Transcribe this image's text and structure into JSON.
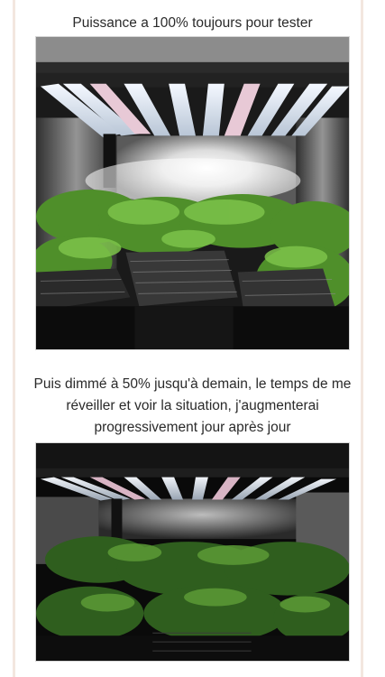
{
  "post": {
    "caption_1": "Puissance a 100% toujours pour tester",
    "caption_2": "Puis dimmé à 50% jusqu'à demain, le temps de me réveiller et voir la situation, j'augmenterai progressivement jour après jour"
  },
  "photos": [
    {
      "icon": "grow-tent-full-power-photo",
      "light_level_percent": 100
    },
    {
      "icon": "grow-tent-dimmed-photo",
      "light_level_percent": 50
    }
  ],
  "colors": {
    "background": "#ffffff",
    "text": "#2a2a2a",
    "page_edge": "#f3e7df"
  }
}
